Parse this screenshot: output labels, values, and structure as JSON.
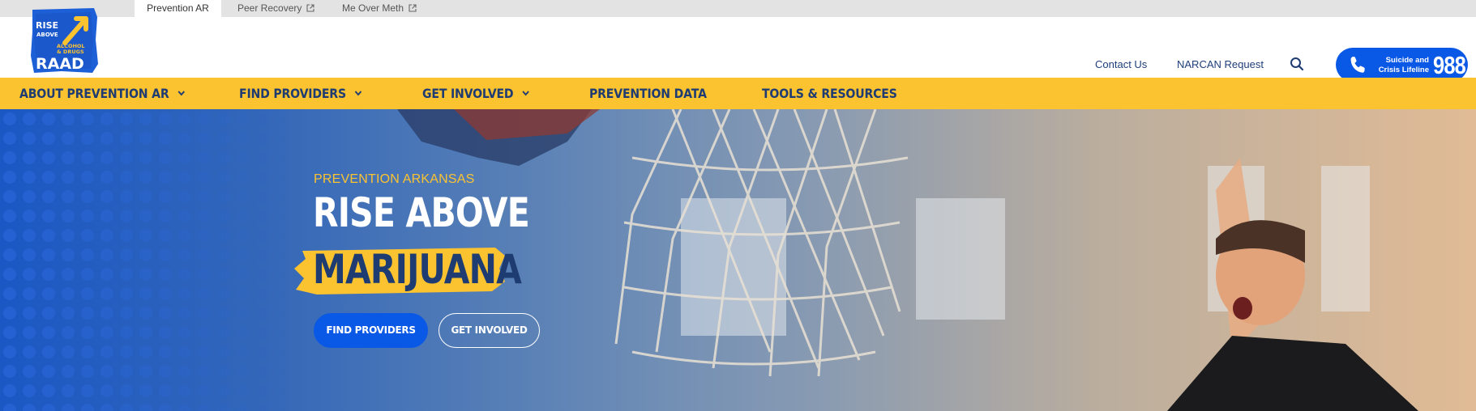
{
  "topbar": {
    "tabs": [
      {
        "label": "Prevention AR",
        "active": true
      },
      {
        "label": "Peer Recovery",
        "external": true
      },
      {
        "label": "Me Over Meth",
        "external": true
      }
    ]
  },
  "header": {
    "logo": {
      "line1": "RISE",
      "line2": "ABOVE",
      "line3": "ALCOHOL",
      "line4": "& DRUGS",
      "wordmark": "RAAD"
    },
    "links": [
      "Contact Us",
      "NARCAN Request"
    ],
    "search_icon": "search-icon",
    "lifeline": {
      "text_line1": "Suicide and",
      "text_line2": "Crisis Lifeline",
      "number": "988"
    }
  },
  "nav": {
    "items": [
      {
        "label": "ABOUT PREVENTION AR",
        "dropdown": true
      },
      {
        "label": "FIND PROVIDERS",
        "dropdown": true
      },
      {
        "label": "GET INVOLVED",
        "dropdown": true
      },
      {
        "label": "PREVENTION DATA",
        "dropdown": false
      },
      {
        "label": "TOOLS & RESOURCES",
        "dropdown": false
      }
    ]
  },
  "hero": {
    "eyebrow": "PREVENTION ARKANSAS",
    "heading_line1": "RISE ABOVE",
    "heading_line2": "MARIJUANA",
    "buttons": {
      "primary": "FIND PROVIDERS",
      "secondary": "GET INVOLVED"
    }
  },
  "colors": {
    "brand_blue": "#0a58e6",
    "brand_yellow": "#fcc330",
    "navy": "#1e3c72"
  }
}
